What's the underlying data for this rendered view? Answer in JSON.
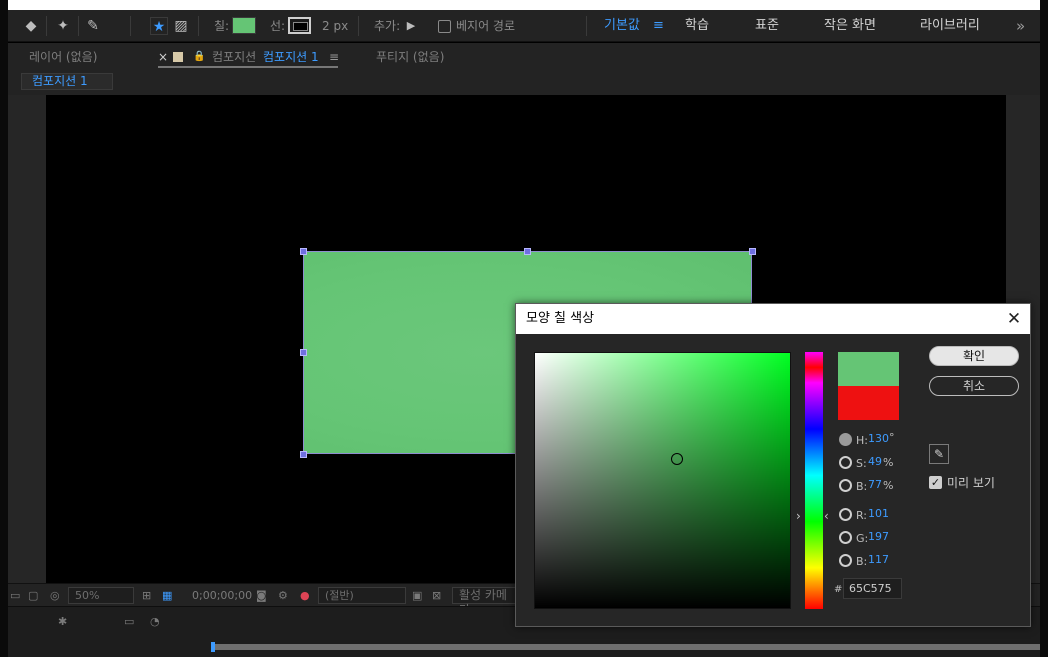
{
  "toolbar": {
    "fill_label": "칠:",
    "stroke_label": "선:",
    "stroke_width": "2 px",
    "add_label": "추가:",
    "bezier_label": "베지어 경로",
    "fill_color": "#65C575"
  },
  "workspaces": {
    "items": [
      "기본값",
      "학습",
      "표준",
      "작은 화면",
      "라이브러리"
    ],
    "active": "기본값",
    "more_icon": "»"
  },
  "panels": {
    "layer_tab": "레이어 (없음)",
    "comp_tab_prefix": "컴포지션",
    "comp_tab_name": "컴포지션 1",
    "footage_tab": "푸티지 (없음)",
    "sub_tab": "컴포지션 1",
    "close_glyph": "×",
    "menu_glyph": "≡"
  },
  "viewer_footer": {
    "zoom": "50%",
    "timecode": "0;00;00;00",
    "resolution": "(절반)",
    "camera": "활성 카메라"
  },
  "dialog": {
    "title": "모양 칠 색상",
    "ok_label": "확인",
    "cancel_label": "취소",
    "preview_label": "미리 보기",
    "preview_checked": true,
    "new_color": "#65C575",
    "old_color": "#EE1111",
    "selected_mode": "H",
    "fields": {
      "H": {
        "label": "H:",
        "value": "130",
        "unit": "°"
      },
      "S": {
        "label": "S:",
        "value": "49",
        "unit": "%"
      },
      "B": {
        "label": "B:",
        "value": "77",
        "unit": "%"
      },
      "R": {
        "label": "R:",
        "value": "101",
        "unit": ""
      },
      "G": {
        "label": "G:",
        "value": "197",
        "unit": ""
      },
      "Bl": {
        "label": "B:",
        "value": "117",
        "unit": ""
      }
    },
    "hash": "#",
    "hex": "65C575"
  }
}
